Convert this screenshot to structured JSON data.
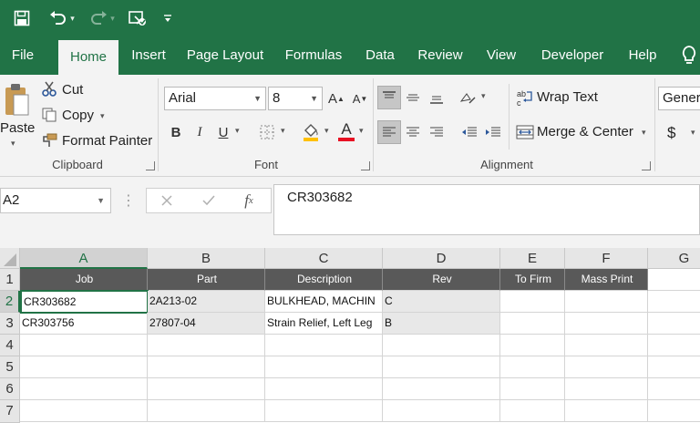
{
  "ribbon_tabs": [
    "File",
    "Home",
    "Insert",
    "Page Layout",
    "Formulas",
    "Data",
    "Review",
    "View",
    "Developer",
    "Help"
  ],
  "clipboard": {
    "paste": "Paste",
    "cut": "Cut",
    "copy": "Copy",
    "format_painter": "Format Painter",
    "group_label": "Clipboard"
  },
  "font": {
    "name": "Arial",
    "size": "8",
    "grow": "A",
    "shrink": "A",
    "bold": "B",
    "italic": "I",
    "underline": "U",
    "font_color_letter": "A",
    "group_label": "Font"
  },
  "alignment": {
    "wrap_text": "Wrap Text",
    "merge_center": "Merge & Center",
    "group_label": "Alignment"
  },
  "number": {
    "format": "Gener",
    "currency": "$"
  },
  "formula_bar": {
    "name_box": "A2",
    "value": "CR303682"
  },
  "grid": {
    "columns": [
      "A",
      "B",
      "C",
      "D",
      "E",
      "F",
      "G"
    ],
    "rows": [
      "1",
      "2",
      "3",
      "4",
      "5",
      "6",
      "7"
    ],
    "header_row": [
      "Job",
      "Part",
      "Description",
      "Rev",
      "To Firm",
      "Mass Print"
    ],
    "data_rows": [
      [
        "CR303682",
        "2A213-02",
        "BULKHEAD, MACHIN",
        "C",
        "",
        ""
      ],
      [
        "CR303756",
        "27807-04",
        "Strain Relief, Left Leg",
        "B",
        "",
        ""
      ]
    ]
  },
  "colors": {
    "accent": "#217346",
    "header_fill": "#595959",
    "gray_fill": "#e8e8e8",
    "font_color_bar": "#e81123"
  }
}
